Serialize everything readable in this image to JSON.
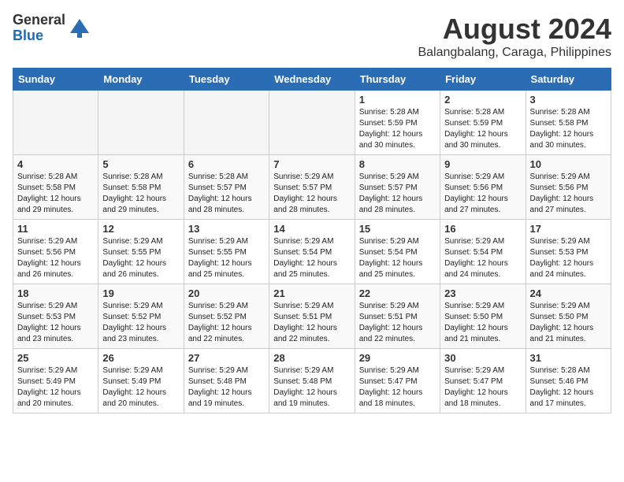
{
  "logo": {
    "general": "General",
    "blue": "Blue"
  },
  "title": "August 2024",
  "subtitle": "Balangbalang, Caraga, Philippines",
  "days_of_week": [
    "Sunday",
    "Monday",
    "Tuesday",
    "Wednesday",
    "Thursday",
    "Friday",
    "Saturday"
  ],
  "weeks": [
    {
      "days": [
        {
          "num": "",
          "info": ""
        },
        {
          "num": "",
          "info": ""
        },
        {
          "num": "",
          "info": ""
        },
        {
          "num": "",
          "info": ""
        },
        {
          "num": "1",
          "info": "Sunrise: 5:28 AM\nSunset: 5:59 PM\nDaylight: 12 hours\nand 30 minutes."
        },
        {
          "num": "2",
          "info": "Sunrise: 5:28 AM\nSunset: 5:59 PM\nDaylight: 12 hours\nand 30 minutes."
        },
        {
          "num": "3",
          "info": "Sunrise: 5:28 AM\nSunset: 5:58 PM\nDaylight: 12 hours\nand 30 minutes."
        }
      ]
    },
    {
      "days": [
        {
          "num": "4",
          "info": "Sunrise: 5:28 AM\nSunset: 5:58 PM\nDaylight: 12 hours\nand 29 minutes."
        },
        {
          "num": "5",
          "info": "Sunrise: 5:28 AM\nSunset: 5:58 PM\nDaylight: 12 hours\nand 29 minutes."
        },
        {
          "num": "6",
          "info": "Sunrise: 5:28 AM\nSunset: 5:57 PM\nDaylight: 12 hours\nand 28 minutes."
        },
        {
          "num": "7",
          "info": "Sunrise: 5:29 AM\nSunset: 5:57 PM\nDaylight: 12 hours\nand 28 minutes."
        },
        {
          "num": "8",
          "info": "Sunrise: 5:29 AM\nSunset: 5:57 PM\nDaylight: 12 hours\nand 28 minutes."
        },
        {
          "num": "9",
          "info": "Sunrise: 5:29 AM\nSunset: 5:56 PM\nDaylight: 12 hours\nand 27 minutes."
        },
        {
          "num": "10",
          "info": "Sunrise: 5:29 AM\nSunset: 5:56 PM\nDaylight: 12 hours\nand 27 minutes."
        }
      ]
    },
    {
      "days": [
        {
          "num": "11",
          "info": "Sunrise: 5:29 AM\nSunset: 5:56 PM\nDaylight: 12 hours\nand 26 minutes."
        },
        {
          "num": "12",
          "info": "Sunrise: 5:29 AM\nSunset: 5:55 PM\nDaylight: 12 hours\nand 26 minutes."
        },
        {
          "num": "13",
          "info": "Sunrise: 5:29 AM\nSunset: 5:55 PM\nDaylight: 12 hours\nand 25 minutes."
        },
        {
          "num": "14",
          "info": "Sunrise: 5:29 AM\nSunset: 5:54 PM\nDaylight: 12 hours\nand 25 minutes."
        },
        {
          "num": "15",
          "info": "Sunrise: 5:29 AM\nSunset: 5:54 PM\nDaylight: 12 hours\nand 25 minutes."
        },
        {
          "num": "16",
          "info": "Sunrise: 5:29 AM\nSunset: 5:54 PM\nDaylight: 12 hours\nand 24 minutes."
        },
        {
          "num": "17",
          "info": "Sunrise: 5:29 AM\nSunset: 5:53 PM\nDaylight: 12 hours\nand 24 minutes."
        }
      ]
    },
    {
      "days": [
        {
          "num": "18",
          "info": "Sunrise: 5:29 AM\nSunset: 5:53 PM\nDaylight: 12 hours\nand 23 minutes."
        },
        {
          "num": "19",
          "info": "Sunrise: 5:29 AM\nSunset: 5:52 PM\nDaylight: 12 hours\nand 23 minutes."
        },
        {
          "num": "20",
          "info": "Sunrise: 5:29 AM\nSunset: 5:52 PM\nDaylight: 12 hours\nand 22 minutes."
        },
        {
          "num": "21",
          "info": "Sunrise: 5:29 AM\nSunset: 5:51 PM\nDaylight: 12 hours\nand 22 minutes."
        },
        {
          "num": "22",
          "info": "Sunrise: 5:29 AM\nSunset: 5:51 PM\nDaylight: 12 hours\nand 22 minutes."
        },
        {
          "num": "23",
          "info": "Sunrise: 5:29 AM\nSunset: 5:50 PM\nDaylight: 12 hours\nand 21 minutes."
        },
        {
          "num": "24",
          "info": "Sunrise: 5:29 AM\nSunset: 5:50 PM\nDaylight: 12 hours\nand 21 minutes."
        }
      ]
    },
    {
      "days": [
        {
          "num": "25",
          "info": "Sunrise: 5:29 AM\nSunset: 5:49 PM\nDaylight: 12 hours\nand 20 minutes."
        },
        {
          "num": "26",
          "info": "Sunrise: 5:29 AM\nSunset: 5:49 PM\nDaylight: 12 hours\nand 20 minutes."
        },
        {
          "num": "27",
          "info": "Sunrise: 5:29 AM\nSunset: 5:48 PM\nDaylight: 12 hours\nand 19 minutes."
        },
        {
          "num": "28",
          "info": "Sunrise: 5:29 AM\nSunset: 5:48 PM\nDaylight: 12 hours\nand 19 minutes."
        },
        {
          "num": "29",
          "info": "Sunrise: 5:29 AM\nSunset: 5:47 PM\nDaylight: 12 hours\nand 18 minutes."
        },
        {
          "num": "30",
          "info": "Sunrise: 5:29 AM\nSunset: 5:47 PM\nDaylight: 12 hours\nand 18 minutes."
        },
        {
          "num": "31",
          "info": "Sunrise: 5:28 AM\nSunset: 5:46 PM\nDaylight: 12 hours\nand 17 minutes."
        }
      ]
    }
  ]
}
